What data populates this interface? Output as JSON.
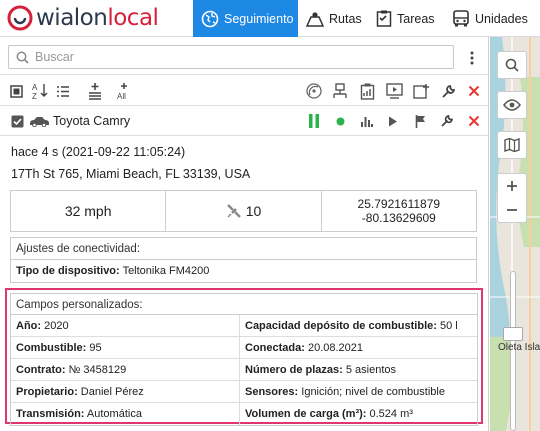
{
  "header": {
    "logo_word1": "wialon",
    "logo_word2": "local",
    "tabs": [
      {
        "label": "Seguimiento",
        "icon": "globe-icon",
        "active": true
      },
      {
        "label": "Rutas",
        "icon": "route-map-icon",
        "active": false
      },
      {
        "label": "Tareas",
        "icon": "tasks-checklist-icon",
        "active": false
      },
      {
        "label": "Unidades",
        "icon": "bus-icon",
        "active": false
      }
    ]
  },
  "search": {
    "placeholder": "Buscar",
    "value": ""
  },
  "unit": {
    "name": "Toyota Camry",
    "last_message": "hace 4 s (2021-09-22 11:05:24)",
    "address": "17Th St 765, Miami Beach, FL 33139, USA",
    "speed": "32 mph",
    "satellites": "10",
    "lat": "25.7921611879",
    "lon": "-80.13629609"
  },
  "connectivity": {
    "title": "Ajustes de conectividad:",
    "device_label": "Tipo de dispositivo:",
    "device_value": "Teltonika FM4200"
  },
  "custom_fields": {
    "title": "Campos personalizados:",
    "rows": [
      [
        {
          "label": "Año:",
          "value": "2020"
        },
        {
          "label": "Capacidad depósito de combustible:",
          "value": "50 l"
        }
      ],
      [
        {
          "label": "Combustible:",
          "value": "95"
        },
        {
          "label": "Conectada:",
          "value": "20.08.2021"
        }
      ],
      [
        {
          "label": "Contrato:",
          "value": "№ 3458129"
        },
        {
          "label": "Número de plazas:",
          "value": "5 asientos"
        }
      ],
      [
        {
          "label": "Propietario:",
          "value": "Daniel Pérez"
        },
        {
          "label": "Sensores:",
          "value": "Ignición; nivel de combustible"
        }
      ],
      [
        {
          "label": "Transmisión:",
          "value": "Automática"
        },
        {
          "label": "Volumen de carga (m³):",
          "value": "0.524 m³"
        }
      ]
    ]
  },
  "map": {
    "label": "Oleta Isla"
  },
  "colors": {
    "accent": "#1e88e5",
    "highlight": "#e0356e",
    "green": "#2bb24c",
    "red": "#e53935"
  }
}
